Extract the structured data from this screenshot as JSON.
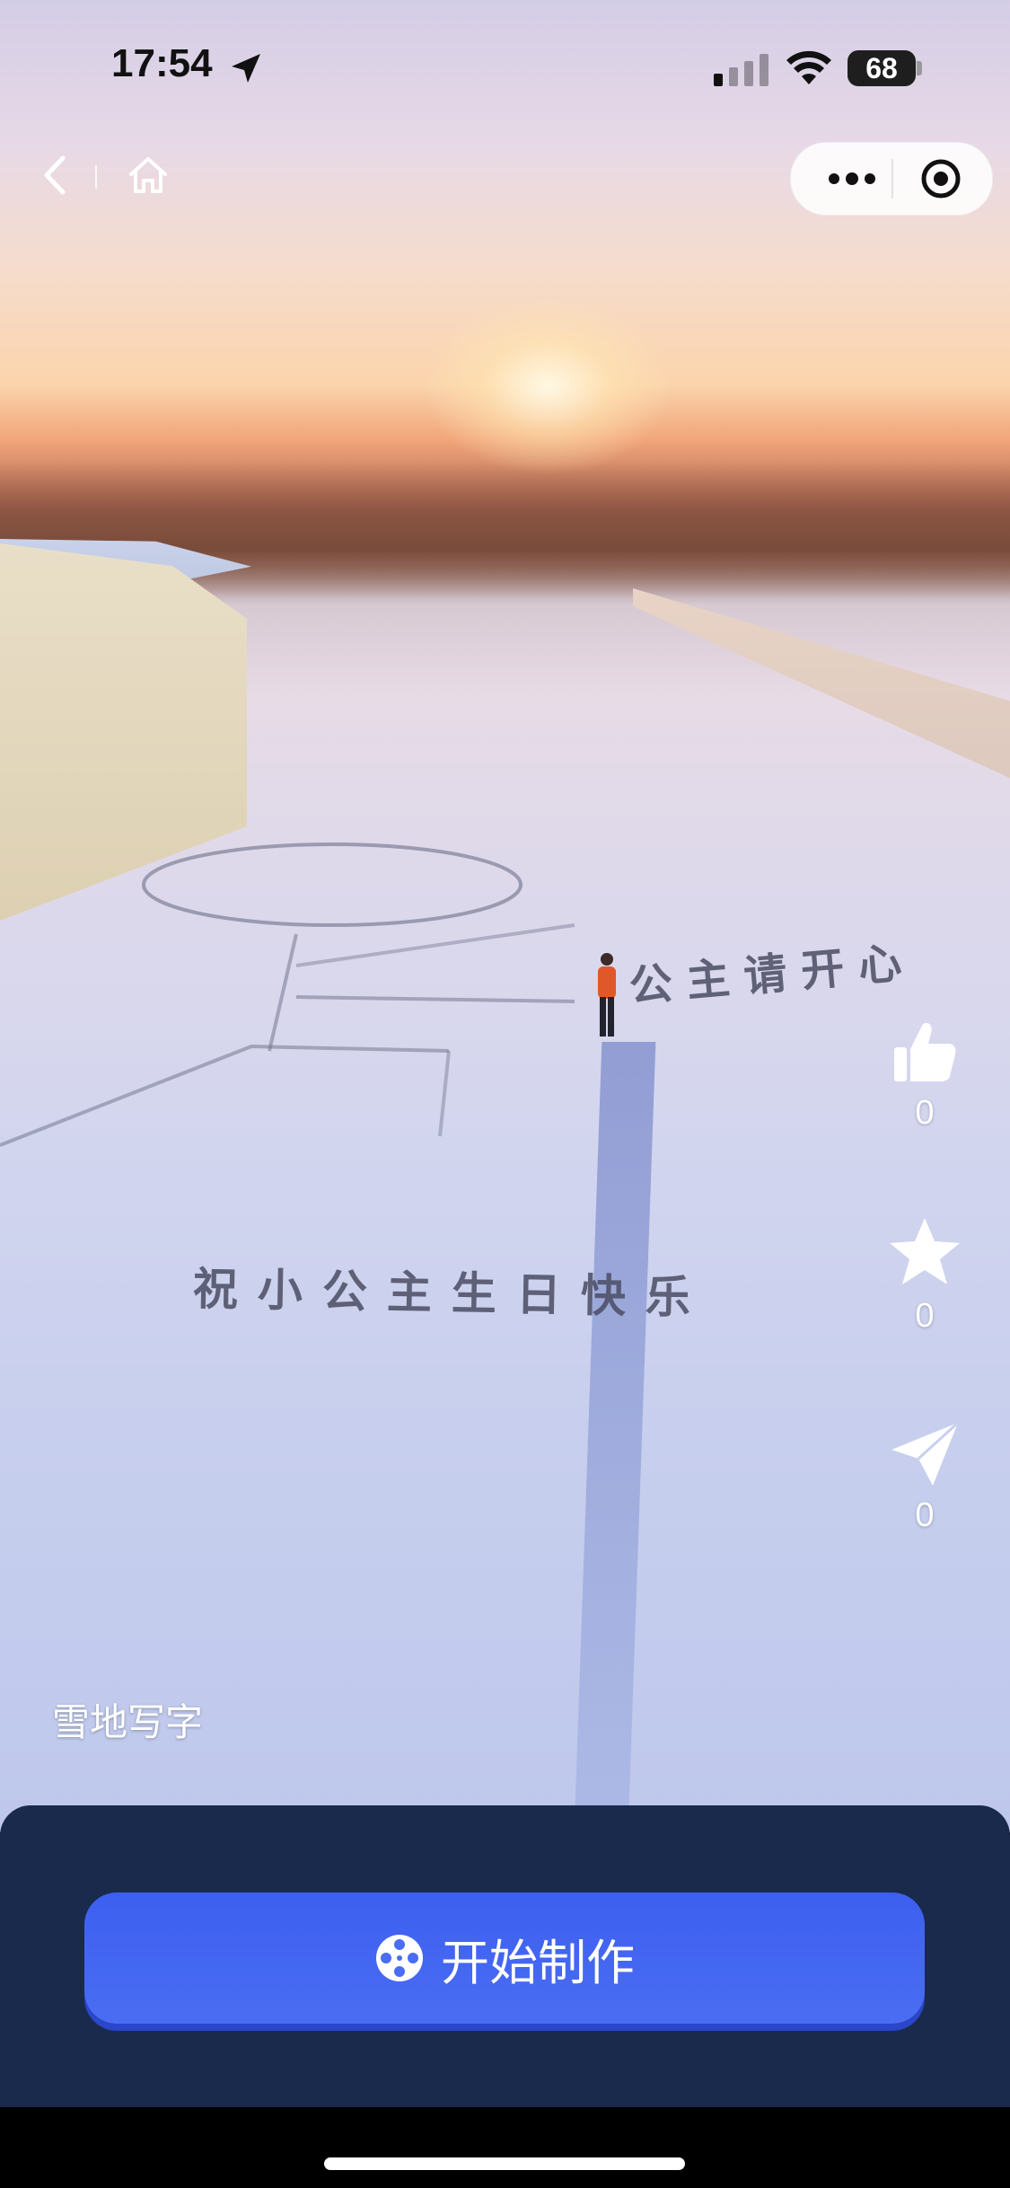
{
  "status_bar": {
    "time": "17:54",
    "battery": "68"
  },
  "nav": {
    "back_icon": "chevron-left-icon",
    "home_icon": "home-icon",
    "more_icon": "more-dots-icon",
    "close_icon": "target-close-icon"
  },
  "video": {
    "snow_text_main": "祝小公主生日快乐",
    "snow_text_side": "公主请开心",
    "caption": "雪地写字"
  },
  "actions": {
    "like": {
      "icon": "thumbs-up-icon",
      "count": "0"
    },
    "favorite": {
      "icon": "star-icon",
      "count": "0"
    },
    "share": {
      "icon": "send-icon",
      "count": "0"
    }
  },
  "bottom": {
    "button_label": "开始制作",
    "button_icon": "film-reel-icon"
  },
  "colors": {
    "panel": "#1a2a4c",
    "button": "#4a6df3"
  }
}
